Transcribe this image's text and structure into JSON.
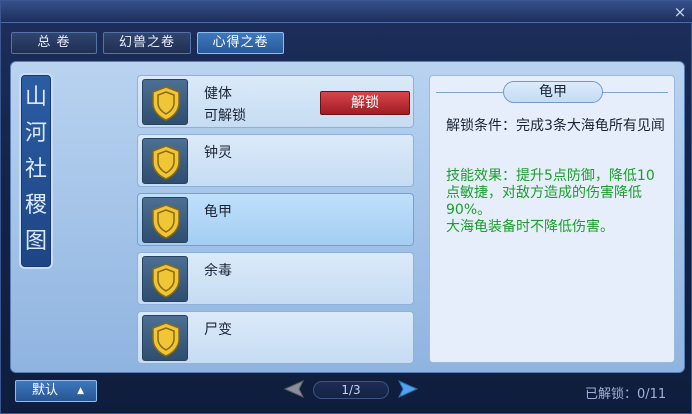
{
  "window": {
    "close": "×"
  },
  "tabs": [
    {
      "label": "总 卷"
    },
    {
      "label": "幻兽之卷"
    },
    {
      "label": "心得之卷"
    }
  ],
  "banner": {
    "chars": [
      "山",
      "河",
      "社",
      "稷",
      "图"
    ]
  },
  "skills": [
    {
      "name": "健体",
      "status": "可解锁",
      "action": "解锁",
      "icon": "shield-icon"
    },
    {
      "name": "钟灵",
      "status": "",
      "icon": "shield-icon"
    },
    {
      "name": "龟甲",
      "status": "",
      "icon": "shield-icon"
    },
    {
      "name": "余毒",
      "status": "",
      "icon": "shield-icon"
    },
    {
      "name": "尸变",
      "status": "",
      "icon": "shield-icon"
    }
  ],
  "detail": {
    "title": "龟甲",
    "condition": "解锁条件：完成3条大海龟所有见闻",
    "effect": "技能效果：提升5点防御，降低10点敏捷，对敌方造成的伤害降低90%。\n大海龟装备时不降低伤害。"
  },
  "footer": {
    "default_label": "默认",
    "page": "1/3",
    "unlocked": "已解锁：0/11"
  },
  "colors": {
    "accent": "#3f78bd",
    "effect_text": "#1a9f2a",
    "unlock_button": "#c4353b"
  }
}
